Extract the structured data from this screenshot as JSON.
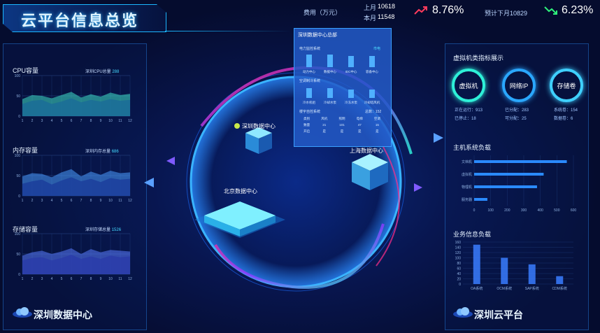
{
  "header": {
    "title": "云平台信息总览",
    "cost_label": "费用（万元）",
    "last_month_label": "上月",
    "last_month_value": "10618",
    "this_month_label": "本月",
    "this_month_value": "11548",
    "pct_up": "8.76%",
    "cumulative_label": "预计下月10829",
    "pct_down": "6.23%"
  },
  "left": {
    "charts": [
      {
        "title": "CPU容量",
        "meta_label": "深圳CPU总量",
        "meta_value": "288",
        "chart_data": {
          "type": "area",
          "x": [
            1,
            2,
            3,
            4,
            5,
            6,
            7,
            8,
            9,
            10,
            11,
            12
          ],
          "y_ticks": [
            "100",
            "50",
            "0"
          ],
          "series": [
            {
              "values": [
                42,
                52,
                50,
                44,
                52,
                60,
                46,
                54,
                48,
                58,
                52,
                55
              ]
            },
            {
              "values": [
                30,
                38,
                40,
                30,
                36,
                44,
                34,
                40,
                36,
                42,
                38,
                40
              ]
            }
          ]
        }
      },
      {
        "title": "内存容量",
        "meta_label": "深圳内存总量",
        "meta_value": "686",
        "chart_data": {
          "type": "area",
          "x": [
            1,
            2,
            3,
            4,
            5,
            6,
            7,
            8,
            9,
            10,
            11,
            12
          ],
          "y_ticks": [
            "100",
            "50",
            "0"
          ],
          "series": [
            {
              "values": [
                48,
                56,
                54,
                46,
                58,
                66,
                48,
                60,
                52,
                62,
                56,
                58
              ]
            },
            {
              "values": [
                30,
                36,
                40,
                28,
                38,
                46,
                36,
                42,
                34,
                44,
                40,
                42
              ]
            }
          ]
        }
      },
      {
        "title": "存储容量",
        "meta_label": "深圳存储总量",
        "meta_value": "1526",
        "chart_data": {
          "type": "area",
          "x": [
            1,
            2,
            3,
            4,
            5,
            6,
            7,
            8,
            9,
            10,
            11,
            12
          ],
          "y_ticks": [
            "100",
            "50",
            "0"
          ],
          "series": [
            {
              "values": [
                46,
                54,
                58,
                50,
                56,
                64,
                50,
                62,
                54,
                60,
                58,
                56
              ]
            },
            {
              "values": [
                34,
                40,
                42,
                34,
                40,
                48,
                38,
                44,
                38,
                46,
                42,
                44
              ]
            }
          ]
        }
      }
    ],
    "footer": "深圳数据中心"
  },
  "center": {
    "nodes": [
      "深圳数据中心",
      "上海数据中心",
      "北京数据中心"
    ],
    "popup": {
      "title": "深圳数据中心总部",
      "power_label": "电力监控系统",
      "power_status": "市电",
      "power_items": [
        "动力中心",
        "数据中心",
        "IDC中心",
        "容备中心"
      ],
      "ac_label": "空调制冷系统",
      "ac_items": [
        "冷水机组",
        "冷却水泵",
        "冷冻水泵",
        "冷却塔风机"
      ],
      "cabinet_label": "楼宇自控系统",
      "cabinet_total": "总数：152",
      "table_headers": [
        "类别",
        "风机",
        "照明",
        "电梯",
        "空调"
      ],
      "table_rows": [
        [
          "数量",
          "21",
          "101",
          "47",
          "15"
        ],
        [
          "开启",
          "是",
          "是",
          "是",
          "是"
        ]
      ]
    }
  },
  "right": {
    "vm_title": "虚拟机类指标展示",
    "circles": [
      "虚拟机",
      "网络IP",
      "存储卷"
    ],
    "stats": [
      {
        "a": "正在运行：913",
        "b": "已停止：18"
      },
      {
        "a": "已分配：283",
        "b": "可分配：25"
      },
      {
        "a": "系统卷：154",
        "b": "数据卷：6"
      }
    ],
    "host_title": "主机系统负载",
    "host_chart": {
      "type": "bar",
      "categories": [
        "文档机",
        "虚拟机",
        "物理机",
        "服务器"
      ],
      "values": [
        560,
        420,
        380,
        80
      ],
      "x_ticks": [
        "0",
        "100",
        "200",
        "300",
        "400",
        "500",
        "600"
      ]
    },
    "biz_title": "业务信息负载",
    "biz_chart": {
      "type": "bar",
      "categories": [
        "OA系统",
        "OCM系统",
        "SAP系统",
        "CDM系统"
      ],
      "values": [
        150,
        100,
        75,
        30
      ],
      "y_ticks": [
        "160",
        "140",
        "120",
        "100",
        "80",
        "60",
        "40",
        "20",
        "0"
      ]
    },
    "footer": "深圳云平台"
  }
}
